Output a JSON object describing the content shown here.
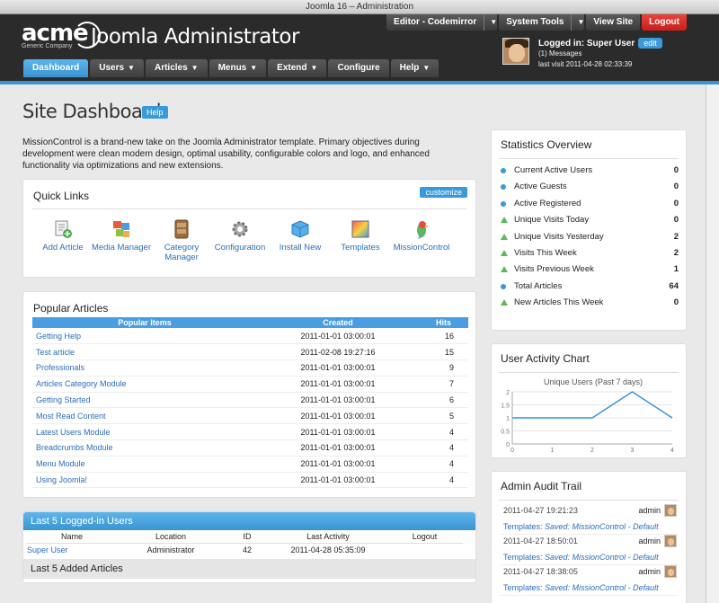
{
  "window_title": "Joomla 16 – Administration",
  "logo": {
    "name": "acme",
    "tagline": "Generic Company"
  },
  "app_title": "Joomla Administrator",
  "top_buttons": {
    "editor": "Editor - Codemirror",
    "system_tools": "System Tools",
    "view_site": "View Site",
    "logout": "Logout"
  },
  "user": {
    "logged_in": "Logged in: Super User",
    "edit": "edit",
    "messages": "(1) Messages",
    "last_visit": "last visit 2011-04-28 02:33:39"
  },
  "nav": [
    "Dashboard",
    "Users",
    "Articles",
    "Menus",
    "Extend",
    "Configure",
    "Help"
  ],
  "page": {
    "title": "Site Dashboard",
    "help": "Help",
    "intro": "MissionControl is a brand-new take on the Joomla Administrator template. Primary objectives during development were clean modern design, optimal usability, configurable colors and logo, and enhanced functionality via optimizations and new extensions."
  },
  "quick_links": {
    "title": "Quick Links",
    "customize": "customize",
    "items": [
      "Add Article",
      "Media Manager",
      "Category Manager",
      "Configuration",
      "Install New",
      "Templates",
      "MissionControl"
    ]
  },
  "popular": {
    "title": "Popular Articles",
    "headers": [
      "Popular Items",
      "Created",
      "Hits"
    ],
    "rows": [
      [
        "Getting Help",
        "2011-01-01 03:00:01",
        "16"
      ],
      [
        "Test article",
        "2011-02-08 19:27:16",
        "15"
      ],
      [
        "Professionals",
        "2011-01-01 03:00:01",
        "9"
      ],
      [
        "Articles Category Module",
        "2011-01-01 03:00:01",
        "7"
      ],
      [
        "Getting Started",
        "2011-01-01 03:00:01",
        "6"
      ],
      [
        "Most Read Content",
        "2011-01-01 03:00:01",
        "5"
      ],
      [
        "Latest Users Module",
        "2011-01-01 03:00:01",
        "4"
      ],
      [
        "Breadcrumbs Module",
        "2011-01-01 03:00:01",
        "4"
      ],
      [
        "Menu Module",
        "2011-01-01 03:00:01",
        "4"
      ],
      [
        "Using Joomla!",
        "2011-01-01 03:00:01",
        "4"
      ]
    ]
  },
  "last_users": {
    "title": "Last 5 Logged-in Users",
    "headers": [
      "Name",
      "Location",
      "ID",
      "Last Activity",
      "Logout"
    ],
    "rows": [
      [
        "Super User",
        "Administrator",
        "42",
        "2011-04-28 05:35:09",
        ""
      ]
    ]
  },
  "last_added": {
    "title": "Last 5 Added Articles"
  },
  "stats": {
    "title": "Statistics Overview",
    "rows": [
      {
        "label": "Current Active Users",
        "value": "0",
        "marker": "dot"
      },
      {
        "label": "Active Guests",
        "value": "0",
        "marker": "dot"
      },
      {
        "label": "Active Registered",
        "value": "0",
        "marker": "dot"
      },
      {
        "label": "Unique Visits Today",
        "value": "0",
        "marker": "tri"
      },
      {
        "label": "Unique Visits Yesterday",
        "value": "2",
        "marker": "tri"
      },
      {
        "label": "Visits This Week",
        "value": "2",
        "marker": "tri"
      },
      {
        "label": "Visits Previous Week",
        "value": "1",
        "marker": "tri"
      },
      {
        "label": "Total Articles",
        "value": "64",
        "marker": "dot"
      },
      {
        "label": "New Articles This Week",
        "value": "0",
        "marker": "tri"
      }
    ]
  },
  "activity": {
    "title": "User Activity Chart",
    "chart_data": {
      "type": "line",
      "title": "Unique Users (Past 7 days)",
      "x": [
        0,
        1,
        2,
        3,
        4
      ],
      "values": [
        1,
        1,
        1,
        2,
        1
      ],
      "xlim": [
        0,
        4
      ],
      "ylim": [
        0,
        2
      ],
      "xticks": [
        "0",
        "1",
        "2",
        "3",
        "4"
      ],
      "yticks": [
        "0",
        "0.5",
        "1",
        "1.5",
        "2"
      ],
      "color": "#3a94d2"
    }
  },
  "audit": {
    "title": "Admin Audit Trail",
    "rows": [
      {
        "time": "2011-04-27 19:21:23",
        "user": "admin",
        "prefix": "Templates:",
        "desc": "Saved: MissionControl - Default"
      },
      {
        "time": "2011-04-27 18:50:01",
        "user": "admin",
        "prefix": "Templates:",
        "desc": "Saved: MissionControl - Default"
      },
      {
        "time": "2011-04-27 18:38:05",
        "user": "admin",
        "prefix": "Templates:",
        "desc": "Saved: MissionControl - Default"
      }
    ]
  },
  "colors": {
    "accent": "#3a94d2",
    "logout": "#d9261f",
    "header": "#2b2b2b"
  }
}
